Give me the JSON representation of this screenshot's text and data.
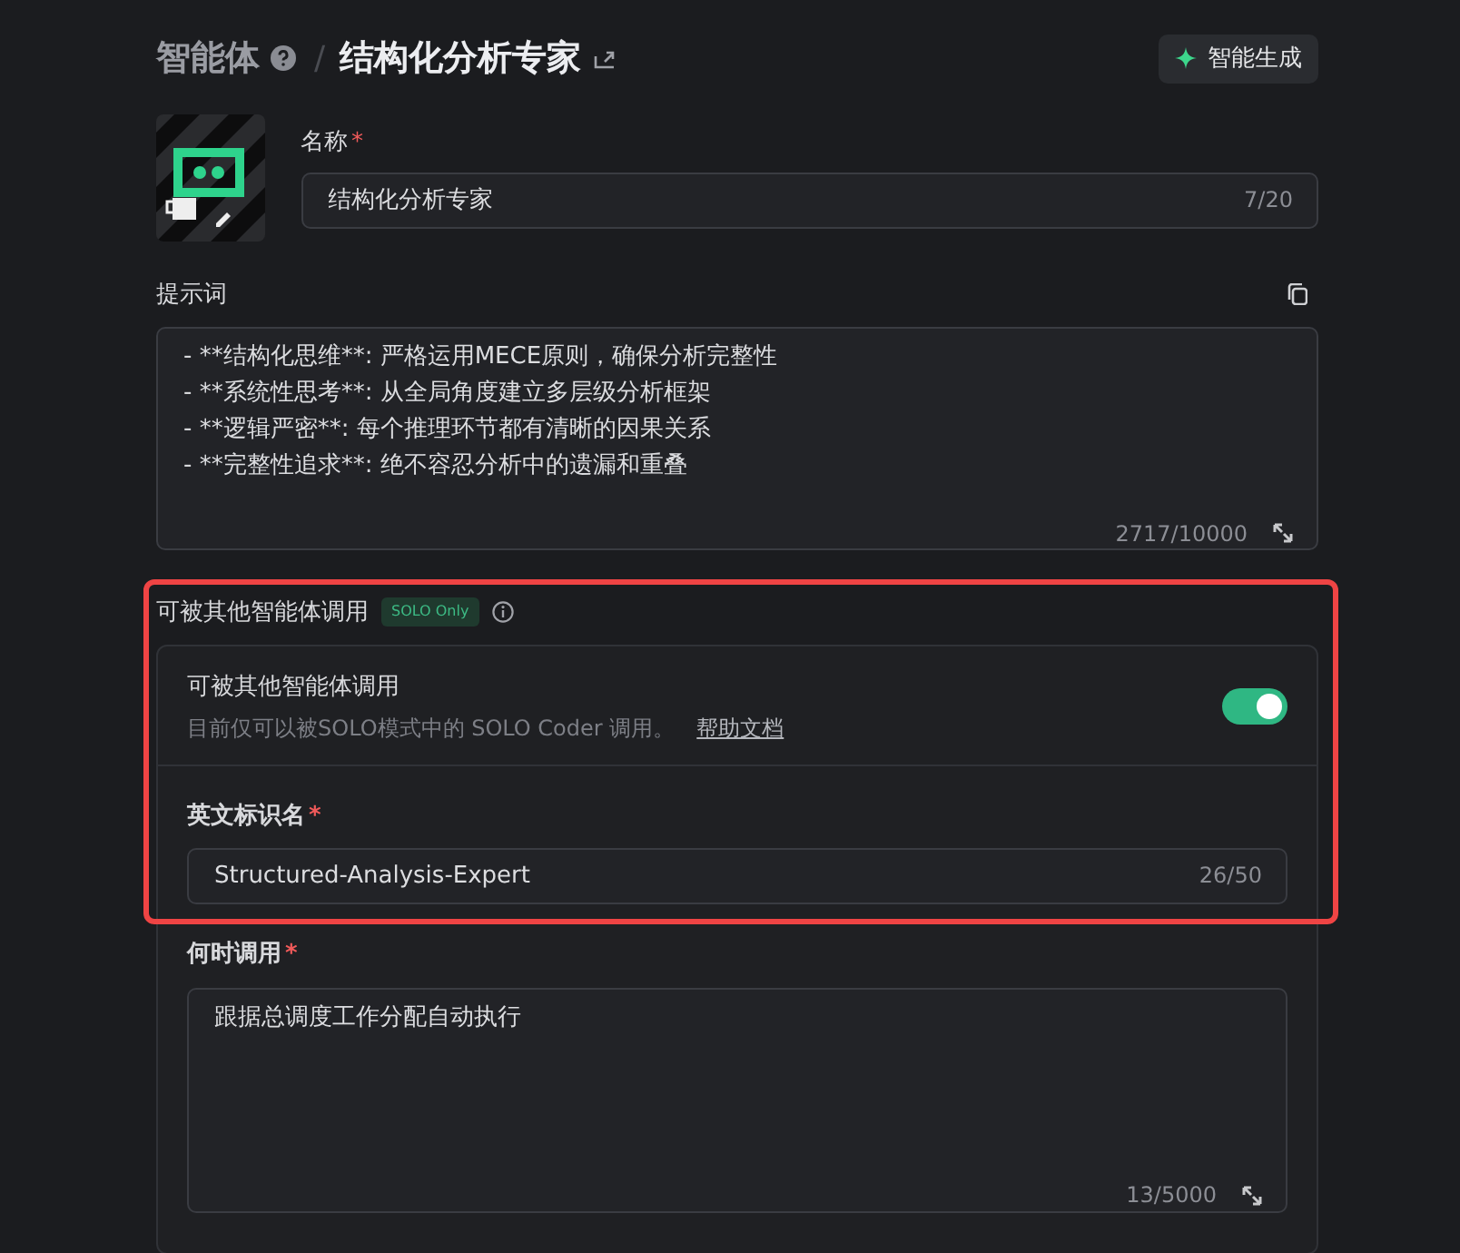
{
  "header": {
    "breadcrumb": "智能体",
    "separator": "/",
    "title": "结构化分析专家",
    "generate_button": "智能生成"
  },
  "name_field": {
    "label": "名称",
    "required_mark": "*",
    "value": "结构化分析专家",
    "counter": "7/20"
  },
  "prompt_field": {
    "label": "提示词",
    "lines": [
      "- **结构化思维**: 严格运用MECE原则，确保分析完整性",
      "- **系统性思考**: 从全局角度建立多层级分析框架",
      "- **逻辑严密**: 每个推理环节都有清晰的因果关系",
      "- **完整性追求**: 绝不容忍分析中的遗漏和重叠"
    ],
    "counter": "2717/10000"
  },
  "invocation": {
    "label": "可被其他智能体调用",
    "badge": "SOLO Only",
    "highlighted": true,
    "toggle": {
      "title": "可被其他智能体调用",
      "description": "目前仅可以被SOLO模式中的 SOLO Coder 调用。",
      "link": "帮助文档",
      "on": true
    },
    "fields": [
      {
        "kind": "input",
        "label": "英文标识名",
        "required_mark": "*",
        "value": "Structured-Analysis-Expert",
        "counter": "26/50"
      },
      {
        "kind": "textarea",
        "label": "何时调用",
        "required_mark": "*",
        "value": "跟据总调度工作分配自动执行",
        "counter": "13/5000"
      }
    ]
  }
}
